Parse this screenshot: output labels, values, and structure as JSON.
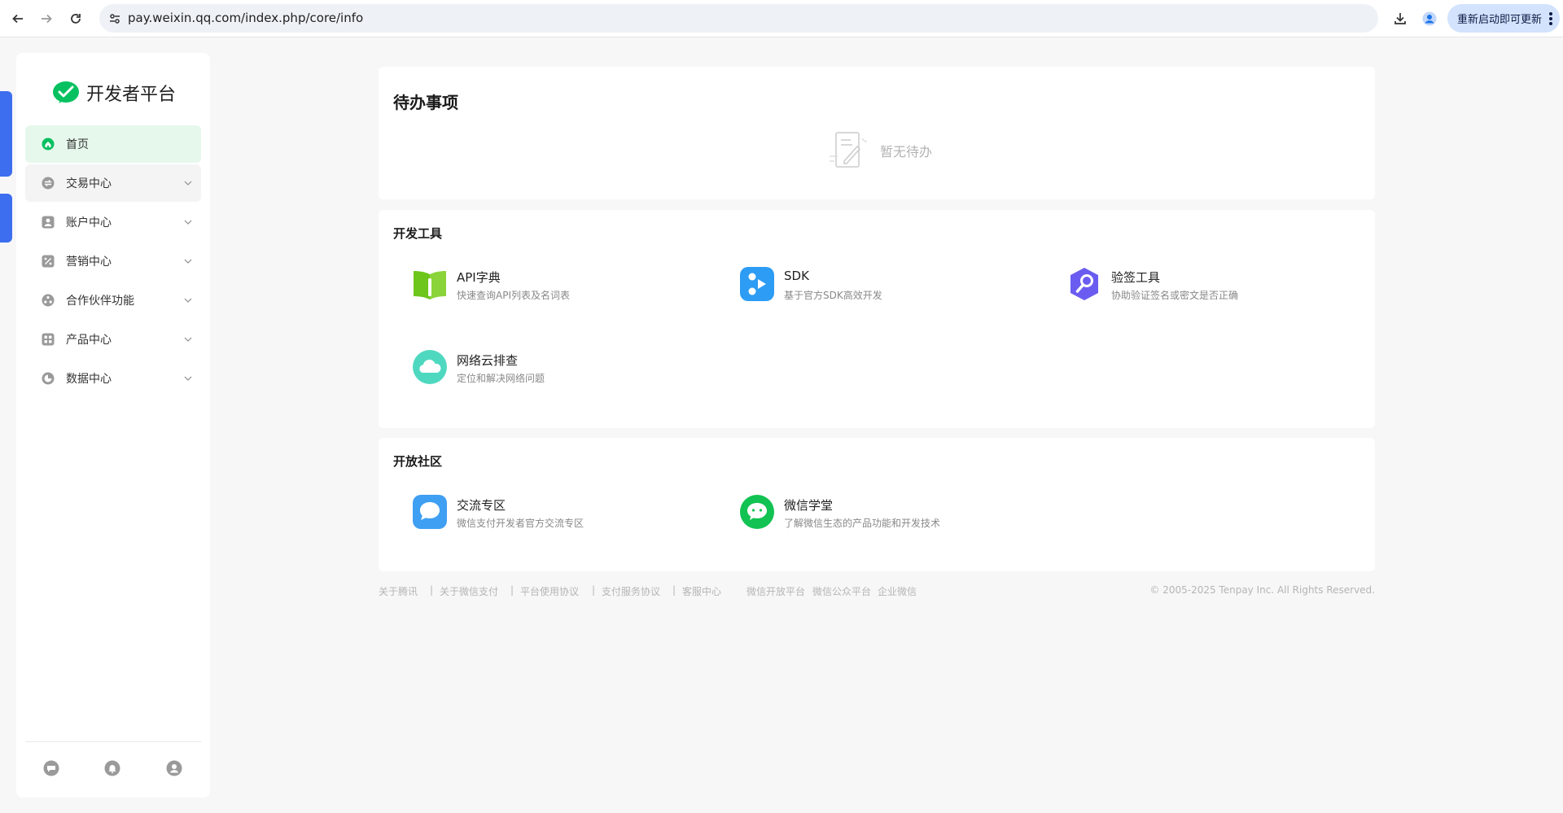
{
  "browser": {
    "url": "pay.weixin.qq.com/index.php/core/info",
    "update_button": "重新启动即可更新"
  },
  "sidebar": {
    "brand": "开发者平台",
    "items": [
      {
        "label": "首页",
        "icon": "home-icon",
        "active": true
      },
      {
        "label": "交易中心",
        "icon": "exchange-icon",
        "expandable": true
      },
      {
        "label": "账户中心",
        "icon": "account-icon",
        "expandable": true
      },
      {
        "label": "营销中心",
        "icon": "discount-icon",
        "expandable": true
      },
      {
        "label": "合作伙伴功能",
        "icon": "partner-icon",
        "expandable": true
      },
      {
        "label": "产品中心",
        "icon": "grid-icon",
        "expandable": true
      },
      {
        "label": "数据中心",
        "icon": "pie-chart-icon",
        "expandable": true
      }
    ],
    "footer_icons": [
      "feedback-icon",
      "bell-icon",
      "user-icon"
    ]
  },
  "todo": {
    "title": "待办事项",
    "empty_text": "暂无待办"
  },
  "dev_tools": {
    "title": "开发工具",
    "items": [
      {
        "name": "API字典",
        "desc": "快速查询API列表及名词表",
        "icon": "book-icon",
        "color": "#6cc61b"
      },
      {
        "name": "SDK",
        "desc": "基于官方SDK高效开发",
        "icon": "sdk-icon",
        "color": "#2d9cf4"
      },
      {
        "name": "验签工具",
        "desc": "协助验证签名或密文是否正确",
        "icon": "verify-icon",
        "color": "#6a5cf0"
      },
      {
        "name": "网络云排查",
        "desc": "定位和解决网络问题",
        "icon": "cloud-icon",
        "color": "#4fd8c0"
      }
    ]
  },
  "community": {
    "title": "开放社区",
    "items": [
      {
        "name": "交流专区",
        "desc": "微信支付开发者官方交流专区",
        "icon": "chat-icon",
        "color": "#3f9ff2"
      },
      {
        "name": "微信学堂",
        "desc": "了解微信生态的产品功能和开发技术",
        "icon": "wechat-icon",
        "color": "#12c252"
      }
    ]
  },
  "footer": {
    "links": [
      "关于腾讯",
      "关于微信支付",
      "平台使用协议",
      "支付服务协议",
      "客服中心",
      "微信开放平台",
      "微信公众平台",
      "企业微信"
    ],
    "copyright": "© 2005-2025 Tenpay Inc. All Rights Reserved."
  },
  "colors": {
    "brand_green": "#07c160",
    "active_bg": "#e6f8ec",
    "ribbon_blue": "#3d6ef0"
  }
}
